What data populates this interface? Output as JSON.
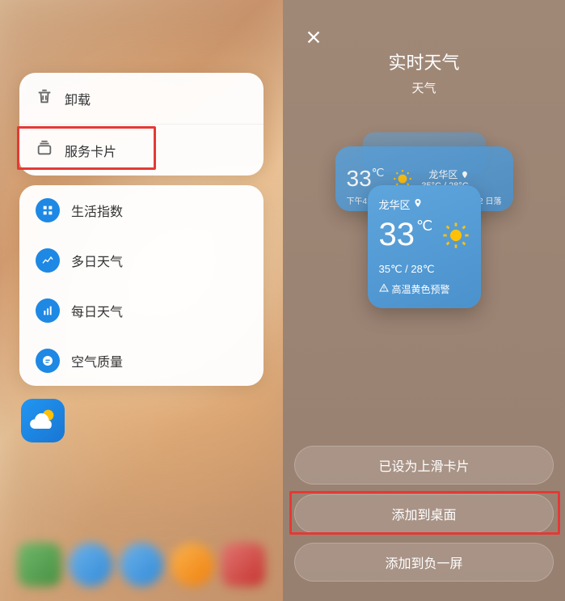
{
  "left": {
    "topMenu": {
      "uninstall": "卸载",
      "serviceCard": "服务卡片"
    },
    "options": [
      {
        "label": "生活指数",
        "iconName": "grid-icon"
      },
      {
        "label": "多日天气",
        "iconName": "chart-line-icon"
      },
      {
        "label": "每日天气",
        "iconName": "bar-chart-icon"
      },
      {
        "label": "空气质量",
        "iconName": "leaf-icon"
      }
    ]
  },
  "right": {
    "title": "实时天气",
    "subtitle": "天气",
    "cardMid": {
      "temp": "33",
      "unit": "℃",
      "location": "龙华区",
      "range": "35°C / 28°C",
      "timeLeft": "下午4:00",
      "timeRight": "晚上7:12",
      "sunset": "日落"
    },
    "cardFront": {
      "location": "龙华区",
      "temp": "33",
      "unit": "℃",
      "range": "35℃ / 28℃",
      "warning": "高温黄色预警"
    },
    "buttons": {
      "setSwipe": "已设为上滑卡片",
      "addDesktop": "添加到桌面",
      "addMinus": "添加到负一屏"
    }
  }
}
